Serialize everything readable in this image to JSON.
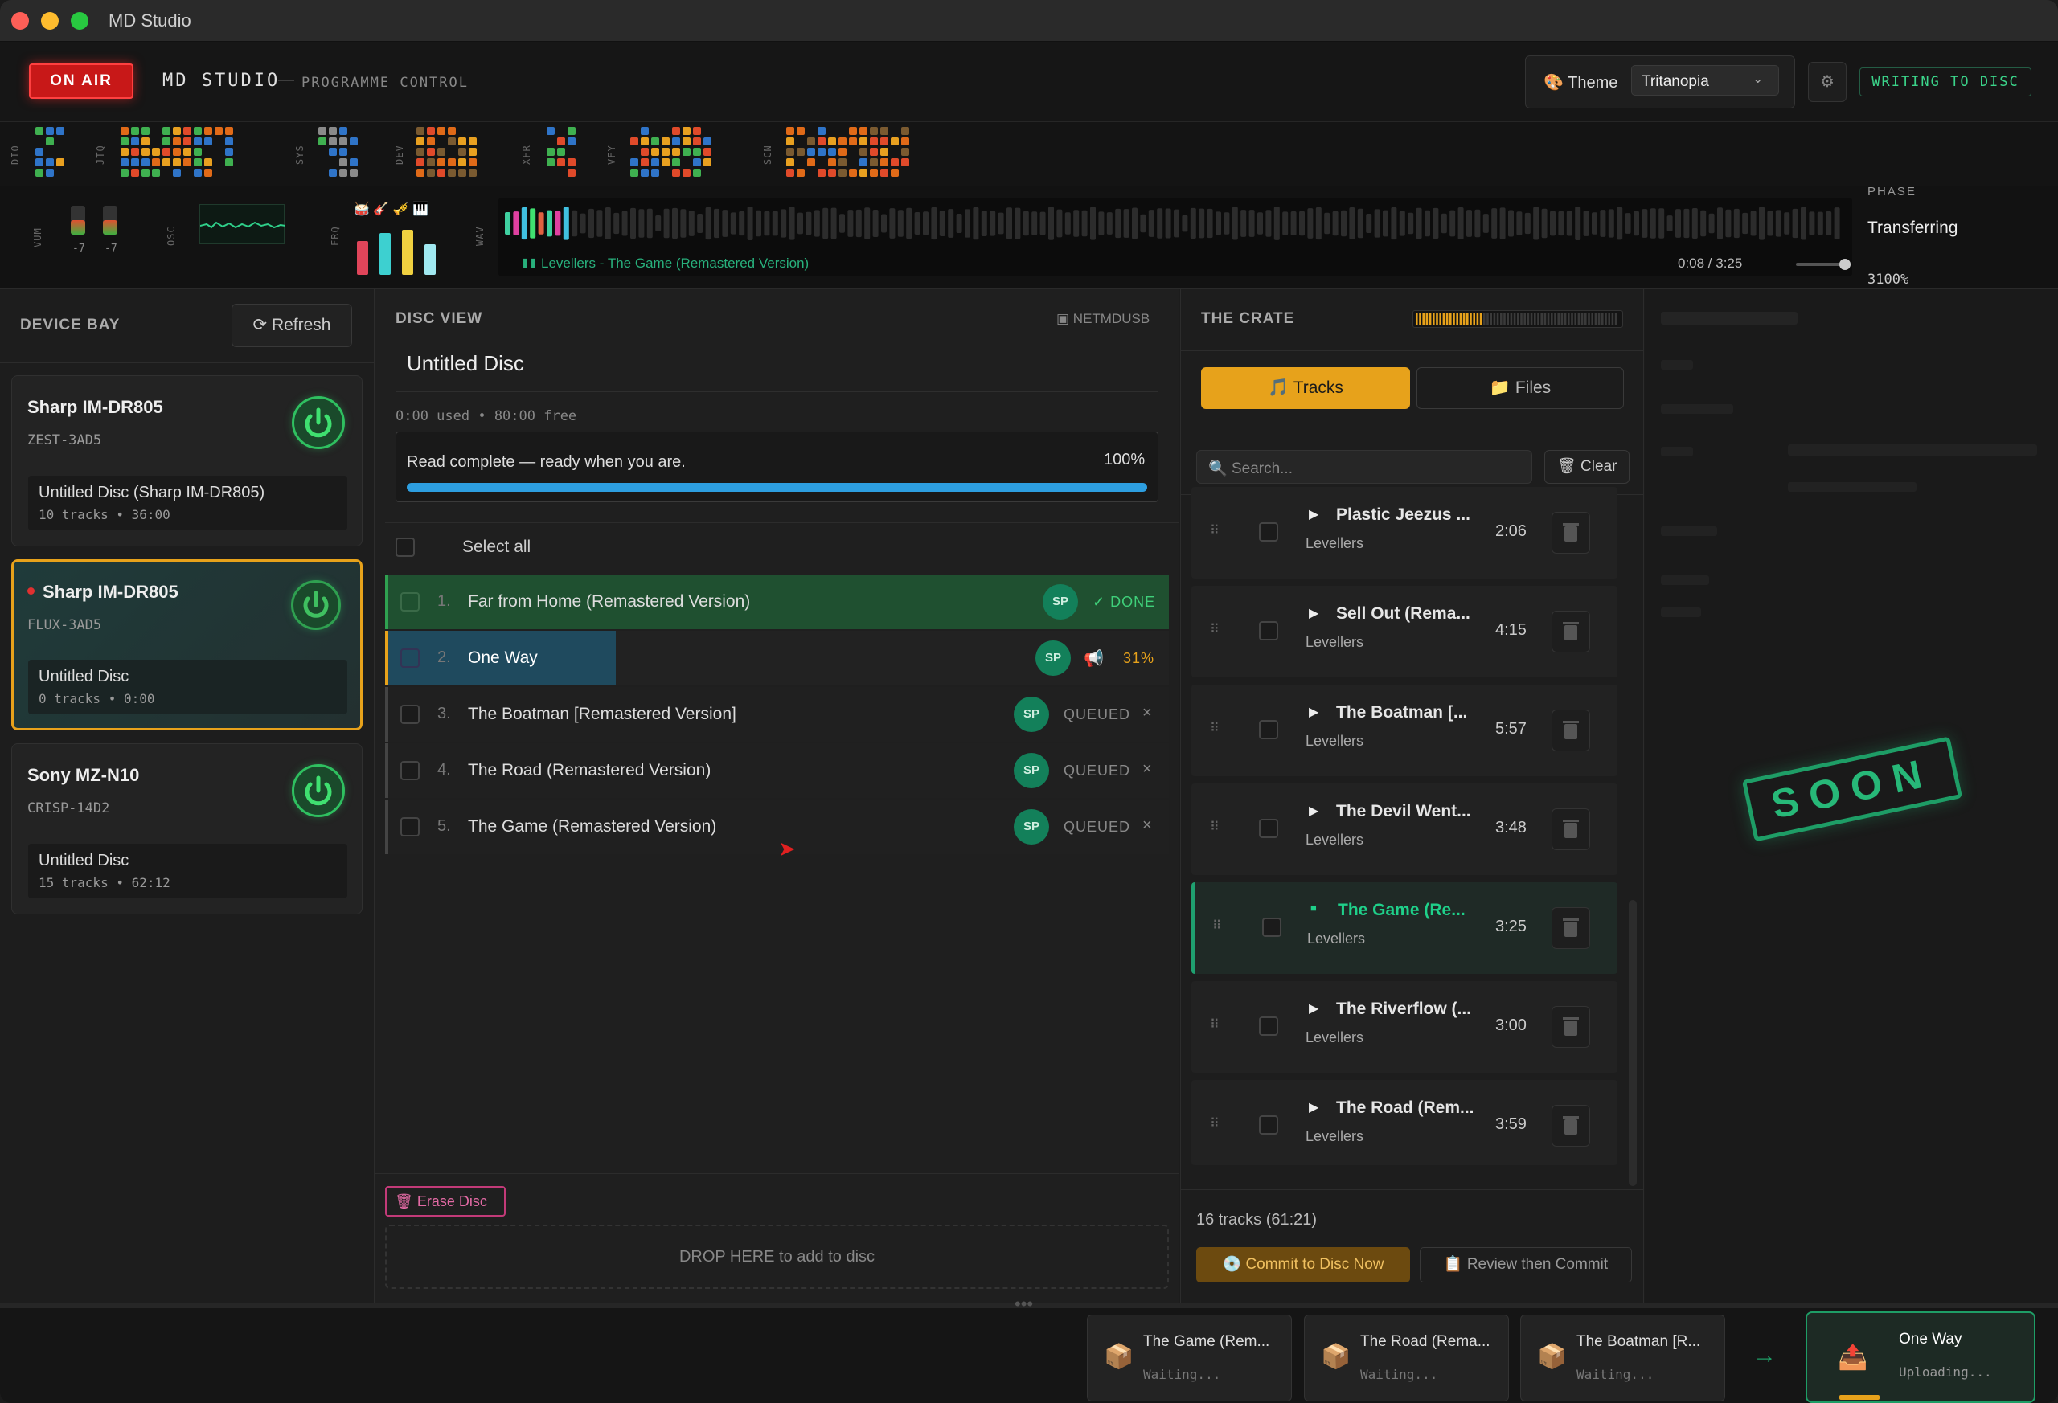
{
  "window": {
    "title": "MD Studio"
  },
  "header": {
    "on_air": "ON AIR",
    "brand": "MD STUDIO",
    "brand_dash": "—",
    "brand_sub": "PROGRAMME CONTROL",
    "theme_label": "Theme",
    "theme_value": "Tritanopia",
    "status": "WRITING TO DISC"
  },
  "grid_labels": [
    "DIO",
    "JTQ",
    "SYS",
    "DEV",
    "XFR",
    "VFY",
    "SCN"
  ],
  "meters": {
    "labels": [
      "VUM",
      "OSC",
      "FRQ",
      "WAV"
    ],
    "vu_left": "-7",
    "vu_right": "-7",
    "now_playing": "Levellers - The Game (Remastered Version)",
    "timecode": "0:08 / 3:25",
    "phase_label": "PHASE",
    "phase_value": "Transferring",
    "phase_pct": "3100%"
  },
  "device_bay": {
    "title": "DEVICE BAY",
    "refresh": "Refresh",
    "devices": [
      {
        "name": "Sharp IM-DR805",
        "id": "ZEST-3AD5",
        "disc": "Untitled Disc (Sharp IM-DR805)",
        "summary": "10 tracks • 36:00"
      },
      {
        "name": "Sharp IM-DR805",
        "id": "FLUX-3AD5",
        "disc": "Untitled Disc",
        "summary": "0 tracks • 0:00"
      },
      {
        "name": "Sony MZ-N10",
        "id": "CRISP-14D2",
        "disc": "Untitled Disc",
        "summary": "15 tracks • 62:12"
      }
    ]
  },
  "disc_view": {
    "title": "DISC VIEW",
    "tag": "NETMDUSB",
    "disc_name": "Untitled Disc",
    "usage": "0:00 used • 80:00 free",
    "read_status": "Read complete — ready when you are.",
    "read_pct": "100%",
    "read_progress": 1.0,
    "select_all": "Select all",
    "tracks": [
      {
        "num": "1.",
        "name": "Far from Home (Remastered Version)",
        "mode": "SP",
        "status": "DONE"
      },
      {
        "num": "2.",
        "name": "One Way",
        "mode": "SP",
        "status": "31%",
        "progress": 0.31
      },
      {
        "num": "3.",
        "name": "The Boatman [Remastered Version]",
        "mode": "SP",
        "status": "QUEUED"
      },
      {
        "num": "4.",
        "name": "The Road (Remastered Version)",
        "mode": "SP",
        "status": "QUEUED"
      },
      {
        "num": "5.",
        "name": "The Game (Remastered Version)",
        "mode": "SP",
        "status": "QUEUED"
      }
    ],
    "remove_glyph": "×",
    "erase": "Erase Disc",
    "drop": "DROP HERE to add to disc"
  },
  "crate": {
    "title": "THE CRATE",
    "tab_tracks": "Tracks",
    "tab_files": "Files",
    "search_placeholder": "Search...",
    "clear": "Clear",
    "items": [
      {
        "title": "Plastic Jeezus ...",
        "artist": "Levellers",
        "duration": "2:06"
      },
      {
        "title": "Sell Out (Rema...",
        "artist": "Levellers",
        "duration": "4:15"
      },
      {
        "title": "The Boatman [...",
        "artist": "Levellers",
        "duration": "5:57"
      },
      {
        "title": "The Devil Went...",
        "artist": "Levellers",
        "duration": "3:48"
      },
      {
        "title": "The Game (Re...",
        "artist": "Levellers",
        "duration": "3:25",
        "playing": true
      },
      {
        "title": "The Riverflow (...",
        "artist": "Levellers",
        "duration": "3:00"
      },
      {
        "title": "The Road (Rem...",
        "artist": "Levellers",
        "duration": "3:59"
      }
    ],
    "count": "16 tracks (61:21)",
    "commit": "Commit to Disc Now",
    "review": "Review then Commit"
  },
  "soon": "SOON",
  "queue": [
    {
      "title": "The Game (Rem...",
      "status": "Waiting..."
    },
    {
      "title": "The Road (Rema...",
      "status": "Waiting..."
    },
    {
      "title": "The Boatman [R...",
      "status": "Waiting..."
    }
  ],
  "queue_active": {
    "title": "One Way",
    "status": "Uploading..."
  },
  "colors": {
    "accent": "#e7a21b",
    "green": "#2fc060",
    "on_air": "#c81818",
    "progress": "#2d9ee0"
  }
}
